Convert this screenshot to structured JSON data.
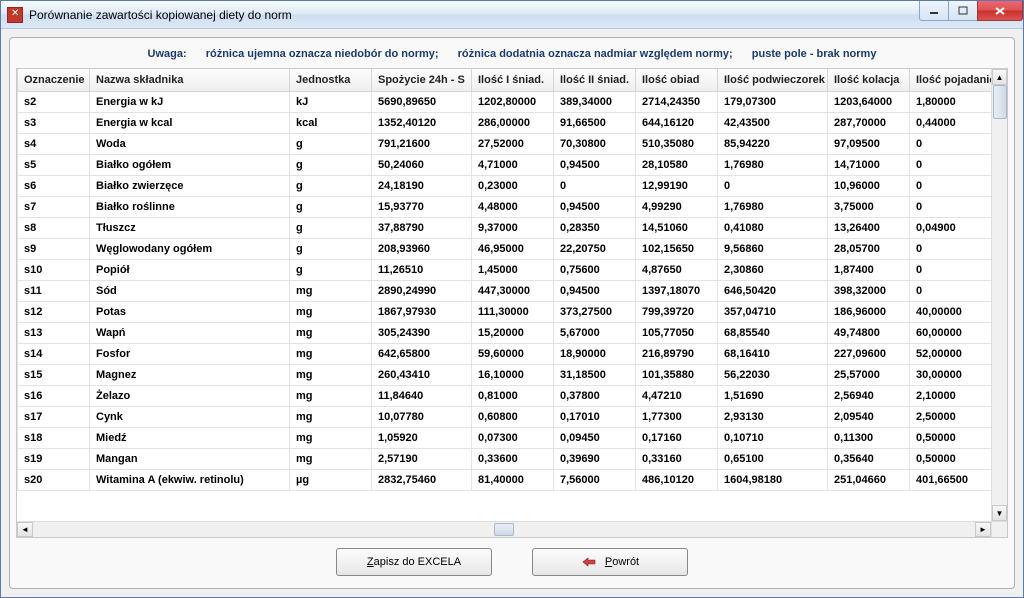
{
  "window": {
    "title": "Porównanie zawartości kopiowanej diety  do norm"
  },
  "warning": {
    "label": "Uwaga:",
    "neg": "różnica ujemna oznacza niedobór do normy;",
    "pos": "różnica dodatnia oznacza nadmiar względem normy;",
    "empty": "puste pole - brak normy"
  },
  "columns": {
    "ozn": "Oznaczenie",
    "name": "Nazwa składnika",
    "unit": "Jednostka",
    "sp24": "Spożycie 24h - S",
    "is1": "Ilość I śniad.",
    "is2": "Ilość II śniad.",
    "obiad": "Ilość obiad",
    "podw": "Ilość podwieczorek",
    "kol": "Ilość kolacja",
    "poj": "Ilość pojadanie"
  },
  "rows": [
    {
      "ozn": "s2",
      "name": "Energia w kJ",
      "unit": "kJ",
      "sp24": "5690,89650",
      "is1": "1202,80000",
      "is2": "389,34000",
      "obiad": "2714,24350",
      "podw": "179,07300",
      "kol": "1203,64000",
      "poj": "1,80000"
    },
    {
      "ozn": "s3",
      "name": "Energia w kcal",
      "unit": "kcal",
      "sp24": "1352,40120",
      "is1": "286,00000",
      "is2": "91,66500",
      "obiad": "644,16120",
      "podw": "42,43500",
      "kol": "287,70000",
      "poj": "0,44000"
    },
    {
      "ozn": "s4",
      "name": "Woda",
      "unit": "g",
      "sp24": "791,21600",
      "is1": "27,52000",
      "is2": "70,30800",
      "obiad": "510,35080",
      "podw": "85,94220",
      "kol": "97,09500",
      "poj": "0"
    },
    {
      "ozn": "s5",
      "name": "Białko ogółem",
      "unit": "g",
      "sp24": "50,24060",
      "is1": "4,71000",
      "is2": "0,94500",
      "obiad": "28,10580",
      "podw": "1,76980",
      "kol": "14,71000",
      "poj": "0"
    },
    {
      "ozn": "s6",
      "name": "Białko zwierzęce",
      "unit": "g",
      "sp24": "24,18190",
      "is1": "0,23000",
      "is2": "0",
      "obiad": "12,99190",
      "podw": "0",
      "kol": "10,96000",
      "poj": "0"
    },
    {
      "ozn": "s7",
      "name": "Białko roślinne",
      "unit": "g",
      "sp24": "15,93770",
      "is1": "4,48000",
      "is2": "0,94500",
      "obiad": "4,99290",
      "podw": "1,76980",
      "kol": "3,75000",
      "poj": "0"
    },
    {
      "ozn": "s8",
      "name": "Tłuszcz",
      "unit": "g",
      "sp24": "37,88790",
      "is1": "9,37000",
      "is2": "0,28350",
      "obiad": "14,51060",
      "podw": "0,41080",
      "kol": "13,26400",
      "poj": "0,04900"
    },
    {
      "ozn": "s9",
      "name": "Węglowodany ogółem",
      "unit": "g",
      "sp24": "208,93960",
      "is1": "46,95000",
      "is2": "22,20750",
      "obiad": "102,15650",
      "podw": "9,56860",
      "kol": "28,05700",
      "poj": "0"
    },
    {
      "ozn": "s10",
      "name": "Popiół",
      "unit": "g",
      "sp24": "11,26510",
      "is1": "1,45000",
      "is2": "0,75600",
      "obiad": "4,87650",
      "podw": "2,30860",
      "kol": "1,87400",
      "poj": "0"
    },
    {
      "ozn": "s11",
      "name": "Sód",
      "unit": "mg",
      "sp24": "2890,24990",
      "is1": "447,30000",
      "is2": "0,94500",
      "obiad": "1397,18070",
      "podw": "646,50420",
      "kol": "398,32000",
      "poj": "0"
    },
    {
      "ozn": "s12",
      "name": "Potas",
      "unit": "mg",
      "sp24": "1867,97930",
      "is1": "111,30000",
      "is2": "373,27500",
      "obiad": "799,39720",
      "podw": "357,04710",
      "kol": "186,96000",
      "poj": "40,00000"
    },
    {
      "ozn": "s13",
      "name": "Wapń",
      "unit": "mg",
      "sp24": "305,24390",
      "is1": "15,20000",
      "is2": "5,67000",
      "obiad": "105,77050",
      "podw": "68,85540",
      "kol": "49,74800",
      "poj": "60,00000"
    },
    {
      "ozn": "s14",
      "name": "Fosfor",
      "unit": "mg",
      "sp24": "642,65800",
      "is1": "59,60000",
      "is2": "18,90000",
      "obiad": "216,89790",
      "podw": "68,16410",
      "kol": "227,09600",
      "poj": "52,00000"
    },
    {
      "ozn": "s15",
      "name": "Magnez",
      "unit": "mg",
      "sp24": "260,43410",
      "is1": "16,10000",
      "is2": "31,18500",
      "obiad": "101,35880",
      "podw": "56,22030",
      "kol": "25,57000",
      "poj": "30,00000"
    },
    {
      "ozn": "s16",
      "name": "Żelazo",
      "unit": "mg",
      "sp24": "11,84640",
      "is1": "0,81000",
      "is2": "0,37800",
      "obiad": "4,47210",
      "podw": "1,51690",
      "kol": "2,56940",
      "poj": "2,10000"
    },
    {
      "ozn": "s17",
      "name": "Cynk",
      "unit": "mg",
      "sp24": "10,07780",
      "is1": "0,60800",
      "is2": "0,17010",
      "obiad": "1,77300",
      "podw": "2,93130",
      "kol": "2,09540",
      "poj": "2,50000"
    },
    {
      "ozn": "s18",
      "name": "Miedź",
      "unit": "mg",
      "sp24": "1,05920",
      "is1": "0,07300",
      "is2": "0,09450",
      "obiad": "0,17160",
      "podw": "0,10710",
      "kol": "0,11300",
      "poj": "0,50000"
    },
    {
      "ozn": "s19",
      "name": "Mangan",
      "unit": "mg",
      "sp24": "2,57190",
      "is1": "0,33600",
      "is2": "0,39690",
      "obiad": "0,33160",
      "podw": "0,65100",
      "kol": "0,35640",
      "poj": "0,50000"
    },
    {
      "ozn": "s20",
      "name": "Witamina A (ekwiw. retinolu)",
      "unit": "µg",
      "sp24": "2832,75460",
      "is1": "81,40000",
      "is2": "7,56000",
      "obiad": "486,10120",
      "podw": "1604,98180",
      "kol": "251,04660",
      "poj": "401,66500"
    }
  ],
  "buttons": {
    "excel_prefix": "Z",
    "excel_rest": "apisz do EXCELA",
    "back_prefix": "P",
    "back_rest": "owrót"
  }
}
